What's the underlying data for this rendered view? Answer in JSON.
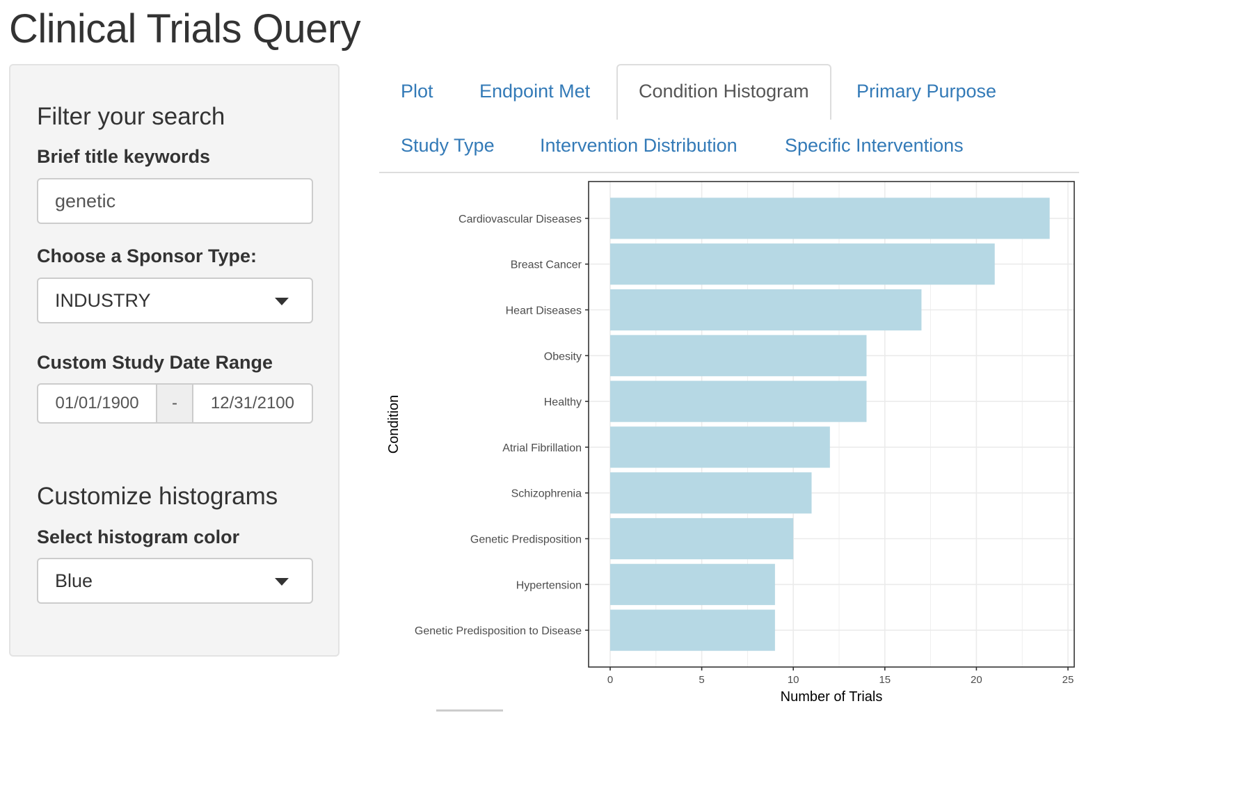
{
  "page": {
    "title": "Clinical Trials Query"
  },
  "sidebar": {
    "filter_heading": "Filter your search",
    "keywords_label": "Brief title keywords",
    "keywords_value": "genetic",
    "sponsor_label": "Choose a Sponsor Type:",
    "sponsor_value": "INDUSTRY",
    "date_label": "Custom Study Date Range",
    "date_start": "01/01/1900",
    "date_separator": "-",
    "date_end": "12/31/2100",
    "customize_heading": "Customize histograms",
    "color_label": "Select histogram color",
    "color_value": "Blue"
  },
  "tabs": [
    {
      "label": "Plot",
      "active": false
    },
    {
      "label": "Endpoint Met",
      "active": false
    },
    {
      "label": "Condition Histogram",
      "active": true
    },
    {
      "label": "Primary Purpose",
      "active": false
    },
    {
      "label": "Study Type",
      "active": false
    },
    {
      "label": "Intervention Distribution",
      "active": false
    },
    {
      "label": "Specific Interventions",
      "active": false
    }
  ],
  "colors": {
    "link": "#337ab7",
    "bar_fill": "#b6d8e4",
    "grid": "#ebebeb",
    "panel_border": "#333333"
  },
  "icons": {
    "select_caret": "chevron-down-icon"
  },
  "chart_data": {
    "type": "bar",
    "orientation": "horizontal",
    "categories": [
      "Cardiovascular Diseases",
      "Breast Cancer",
      "Heart Diseases",
      "Obesity",
      "Healthy",
      "Atrial Fibrillation",
      "Schizophrenia",
      "Genetic Predisposition",
      "Hypertension",
      "Genetic Predisposition to Disease"
    ],
    "values": [
      24,
      21,
      17,
      14,
      14,
      12,
      11,
      10,
      9,
      9
    ],
    "xlabel": "Number of Trials",
    "ylabel": "Condition",
    "xlim": [
      0,
      25
    ],
    "xticks": [
      0,
      5,
      10,
      15,
      20,
      25
    ],
    "grid": true,
    "legend": "none"
  }
}
